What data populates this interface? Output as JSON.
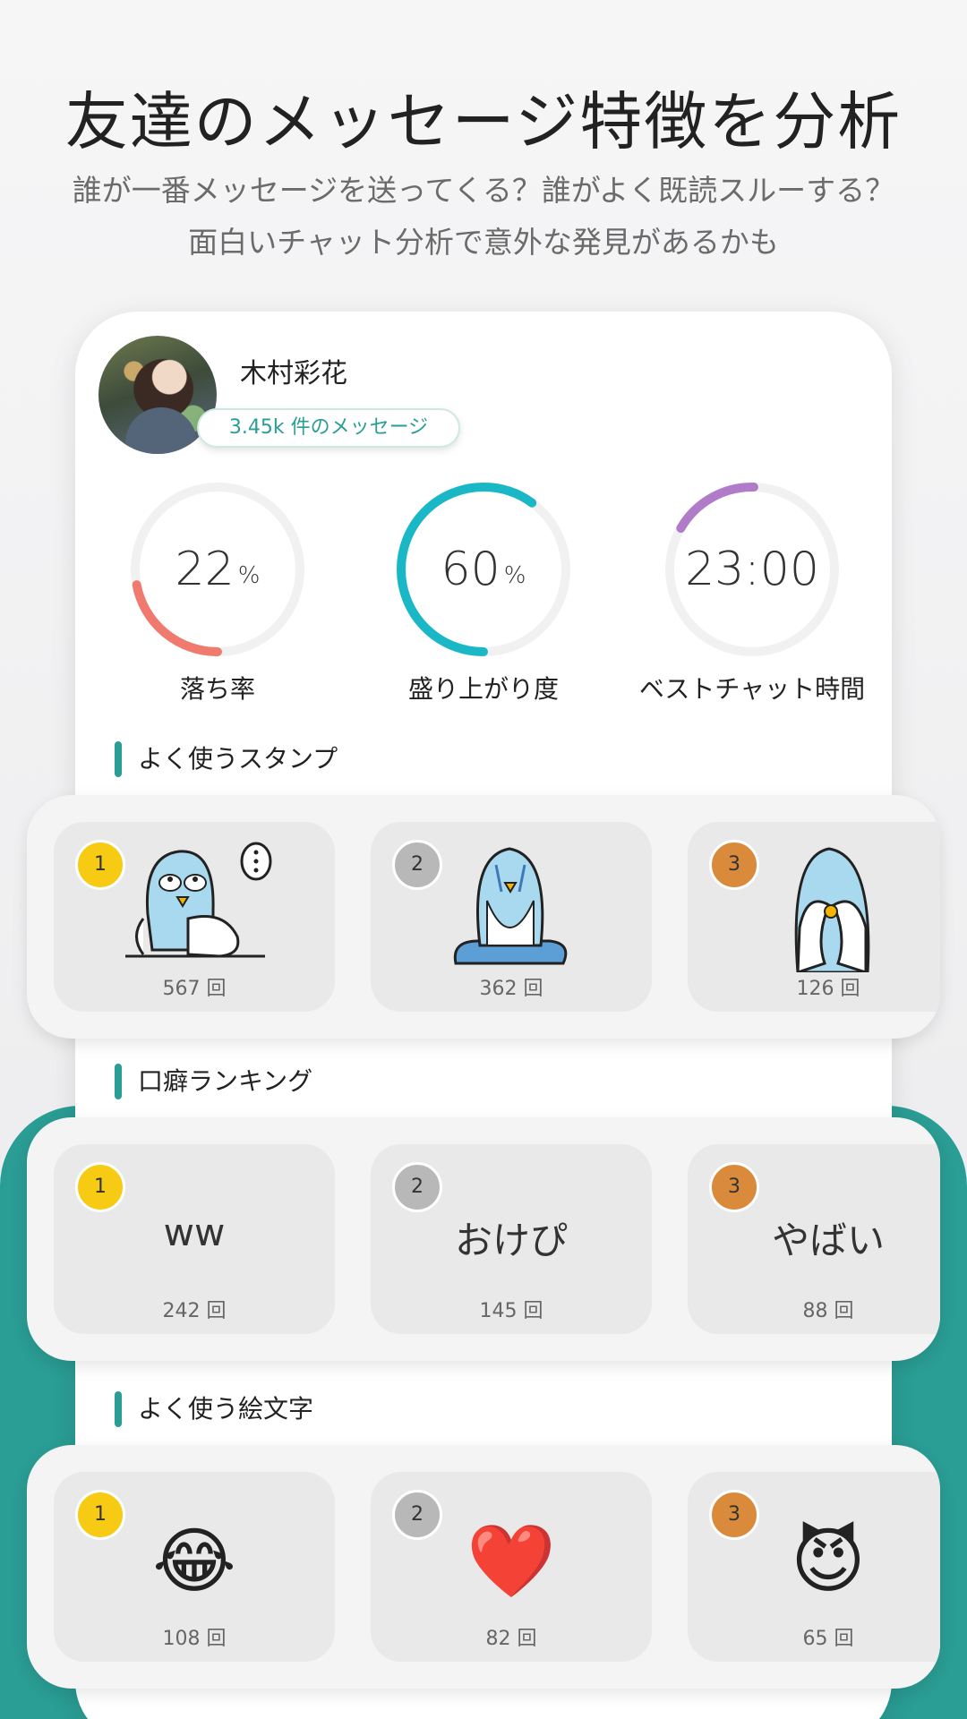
{
  "header": {
    "title": "友達のメッセージ特徴を分析",
    "subtitle_line1": "誰が一番メッセージを送ってくる？誰がよく既読スルーする？",
    "subtitle_line2": "面白いチャット分析で意外な発見があるかも"
  },
  "profile": {
    "name": "木村彩花",
    "message_count": "3.45k 件のメッセージ"
  },
  "stats": [
    {
      "value": "22",
      "unit": "%",
      "label": "落ち率",
      "fraction": 0.22,
      "color": "#f07a6e"
    },
    {
      "value": "60",
      "unit": "%",
      "label": "盛り上がり度",
      "fraction": 0.6,
      "color": "#1ab8c6"
    },
    {
      "value": "23:00",
      "unit": "",
      "label": "ベストチャット時間",
      "fraction": 0.17,
      "color": "#b07cc9"
    }
  ],
  "sections": {
    "stickers": {
      "title": "よく使うスタンプ",
      "items": [
        {
          "rank": "1",
          "count": "567 回",
          "icon": "penguin-thinking-sticker"
        },
        {
          "rank": "2",
          "count": "362 回",
          "icon": "penguin-sitting-sticker"
        },
        {
          "rank": "3",
          "count": "126 回",
          "icon": "penguin-peeking-sticker"
        }
      ]
    },
    "phrases": {
      "title": "口癖ランキング",
      "items": [
        {
          "rank": "1",
          "text": "ww",
          "count": "242 回"
        },
        {
          "rank": "2",
          "text": "おけぴ",
          "count": "145 回"
        },
        {
          "rank": "3",
          "text": "やばい",
          "count": "88 回"
        }
      ]
    },
    "emojis": {
      "title": "よく使う絵文字",
      "items": [
        {
          "rank": "1",
          "emoji": "😂",
          "count": "108 回",
          "icon": "tears-of-joy-emoji"
        },
        {
          "rank": "2",
          "emoji": "❤️",
          "count": "82 回",
          "icon": "red-heart-emoji"
        },
        {
          "rank": "3",
          "emoji": "😈",
          "count": "65 回",
          "icon": "smiling-devil-emoji"
        }
      ]
    }
  }
}
